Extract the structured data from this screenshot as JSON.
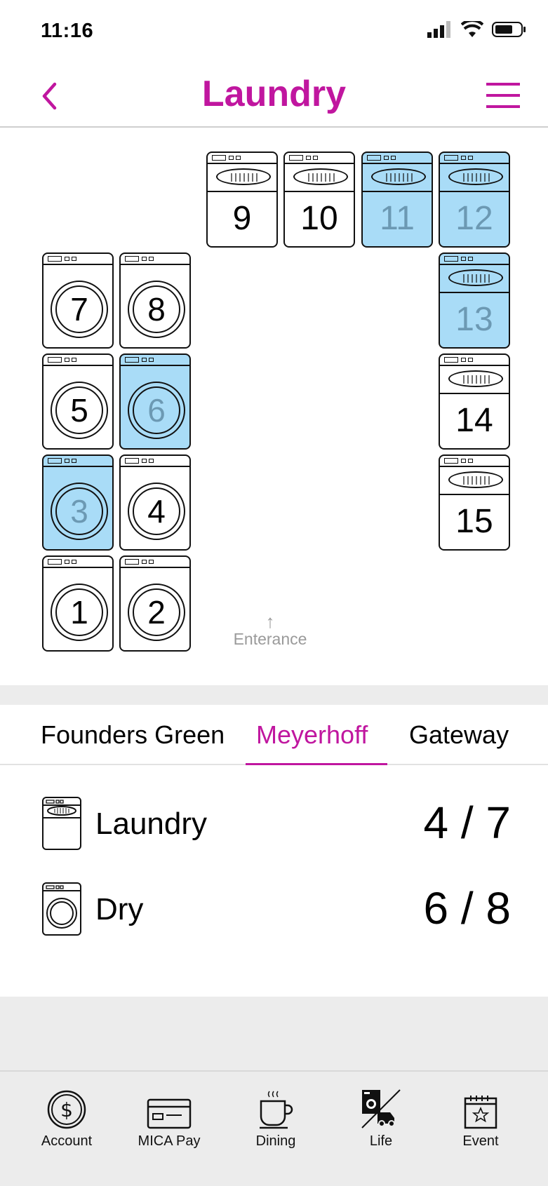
{
  "status": {
    "time": "11:16"
  },
  "header": {
    "title": "Laundry"
  },
  "map": {
    "washers": [
      {
        "number": "9",
        "state": "available"
      },
      {
        "number": "10",
        "state": "available"
      },
      {
        "number": "11",
        "state": "in-use"
      },
      {
        "number": "12",
        "state": "in-use"
      },
      {
        "number": "13",
        "state": "in-use"
      },
      {
        "number": "14",
        "state": "available"
      },
      {
        "number": "15",
        "state": "available"
      }
    ],
    "dryers": [
      {
        "number": "7",
        "state": "available"
      },
      {
        "number": "8",
        "state": "available"
      },
      {
        "number": "5",
        "state": "available"
      },
      {
        "number": "6",
        "state": "in-use"
      },
      {
        "number": "3",
        "state": "in-use"
      },
      {
        "number": "4",
        "state": "available"
      },
      {
        "number": "1",
        "state": "available"
      },
      {
        "number": "2",
        "state": "available"
      }
    ],
    "entrance_label": "Enterance",
    "colors": {
      "in_use": "#a9dcf7",
      "available": "#ffffff"
    }
  },
  "tabs": [
    {
      "label": "Founders Green",
      "active": false
    },
    {
      "label": "Meyerhoff",
      "active": true
    },
    {
      "label": "Gateway",
      "active": false
    }
  ],
  "summary": {
    "laundry": {
      "label": "Laundry",
      "value": "4 / 7"
    },
    "dry": {
      "label": "Dry",
      "value": "6 / 8"
    }
  },
  "nav": [
    {
      "label": "Account",
      "icon": "dollar-coin-icon"
    },
    {
      "label": "MICA Pay",
      "icon": "credit-card-icon"
    },
    {
      "label": "Dining",
      "icon": "coffee-cup-icon"
    },
    {
      "label": "Life",
      "icon": "laundry-truck-icon"
    },
    {
      "label": "Event",
      "icon": "calendar-star-icon"
    }
  ],
  "theme": {
    "accent": "#c0169f"
  }
}
